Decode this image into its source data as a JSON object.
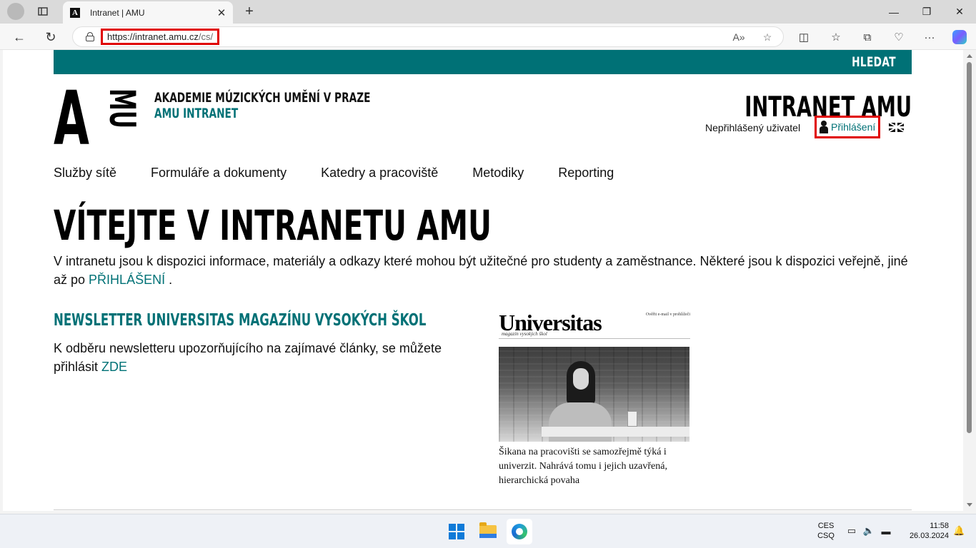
{
  "browser": {
    "tab_title": "Intranet | AMU",
    "tab_favicon": "A",
    "url_host": "https://intranet.amu.cz",
    "url_path": "/cs/",
    "icons": [
      "profile-icon",
      "tab-actions-icon",
      "close-icon",
      "new-tab-icon",
      "minimize-icon",
      "maximize-icon",
      "close-window-icon",
      "back-icon",
      "refresh-icon",
      "lock-icon",
      "read-aloud-icon",
      "favorite-star-icon",
      "split-screen-icon",
      "favorites-icon",
      "collections-icon",
      "browser-essentials-icon",
      "more-icon",
      "copilot-icon"
    ]
  },
  "site": {
    "search_label": "HLEDAT",
    "org_name": "AKADEMIE MÚZICKÝCH UMĚNÍ V PRAZE",
    "org_sub": "AMU INTRANET",
    "site_title": "INTRANET AMU",
    "user_status": "Nepřihlášený uživatel",
    "login_label": "Přihlášení",
    "logo_letters": "AMU",
    "nav": [
      {
        "label": "Služby sítě"
      },
      {
        "label": "Formuláře a dokumenty"
      },
      {
        "label": "Katedry a pracoviště"
      },
      {
        "label": "Metodiky"
      },
      {
        "label": "Reporting"
      }
    ],
    "heading": "VÍTEJTE V INTRANETU AMU",
    "intro_text": "V intranetu jsou k dispozici informace, materiály a odkazy které mohou být užitečné pro studenty a zaměstnance. Některé jsou k dispozici veřejně, jiné až po ",
    "intro_link": "PŘIHLÁŠENÍ",
    "intro_end": " .",
    "news_heading": "NEWSLETTER UNIVERSITAS MAGAZÍNU VYSOKÝCH ŠKOL",
    "news_text": "K odběru newsletteru upozorňujícího na zajímavé články, se můžete přihlásit ",
    "news_link": "ZDE",
    "newsletter_image": {
      "logo": "Universitas",
      "tagline": "magazín vysokých škol",
      "verify": "Ověřit e-mail v prohlížeči",
      "caption": "Šikana na pracovišti se samozřejmě týká i univerzit. Nahrává tomu i jejich uzavřená, hierarchická povaha"
    },
    "accent_color": "#007176"
  },
  "taskbar": {
    "lang_top": "CES",
    "lang_bottom": "CSQ",
    "time": "11:58",
    "date": "26.03.2024"
  }
}
